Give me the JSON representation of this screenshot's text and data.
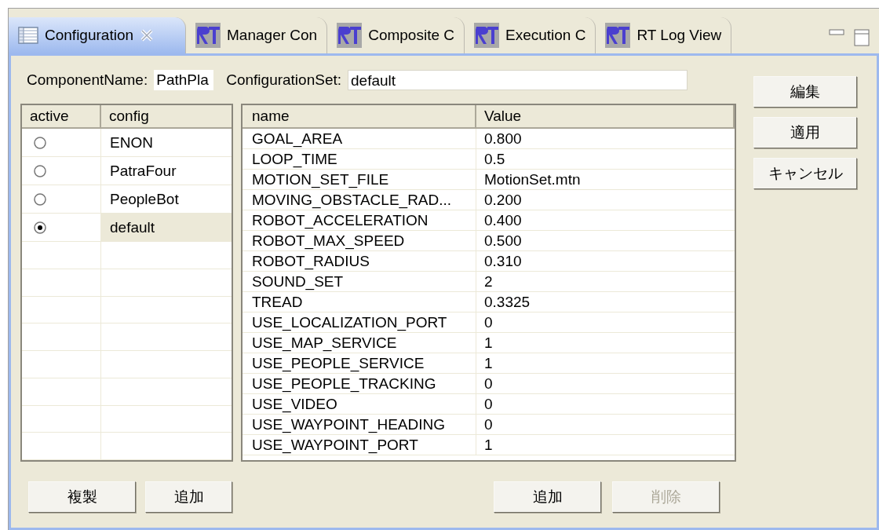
{
  "tabs": [
    {
      "label": "Configuration",
      "kind": "table",
      "selected": true,
      "closable": true
    },
    {
      "label": "Manager Con",
      "kind": "rt",
      "selected": false,
      "closable": false
    },
    {
      "label": "Composite C",
      "kind": "rt",
      "selected": false,
      "closable": false
    },
    {
      "label": "Execution C",
      "kind": "rt",
      "selected": false,
      "closable": false
    },
    {
      "label": "RT Log View",
      "kind": "rt",
      "selected": false,
      "closable": false
    }
  ],
  "component_name": {
    "label": "ComponentName:",
    "value": "PathPla"
  },
  "configuration_set": {
    "label": "ConfigurationSet:",
    "value": "default"
  },
  "config_table": {
    "columns": [
      "active",
      "config"
    ],
    "rows": [
      {
        "config": "ENON",
        "selected": false
      },
      {
        "config": "PatraFour",
        "selected": false
      },
      {
        "config": "PeopleBot",
        "selected": false
      },
      {
        "config": "default",
        "selected": true
      }
    ]
  },
  "param_table": {
    "columns": [
      "name",
      "Value"
    ],
    "rows": [
      {
        "name": "GOAL_AREA",
        "value": "0.800"
      },
      {
        "name": "LOOP_TIME",
        "value": "0.5"
      },
      {
        "name": "MOTION_SET_FILE",
        "value": "MotionSet.mtn"
      },
      {
        "name": "MOVING_OBSTACLE_RAD...",
        "value": "0.200"
      },
      {
        "name": "ROBOT_ACCELERATION",
        "value": "0.400"
      },
      {
        "name": "ROBOT_MAX_SPEED",
        "value": "0.500"
      },
      {
        "name": "ROBOT_RADIUS",
        "value": "0.310"
      },
      {
        "name": "SOUND_SET",
        "value": "2"
      },
      {
        "name": "TREAD",
        "value": "0.3325"
      },
      {
        "name": "USE_LOCALIZATION_PORT",
        "value": "0"
      },
      {
        "name": "USE_MAP_SERVICE",
        "value": "1"
      },
      {
        "name": "USE_PEOPLE_SERVICE",
        "value": "1"
      },
      {
        "name": "USE_PEOPLE_TRACKING",
        "value": "0"
      },
      {
        "name": "USE_VIDEO",
        "value": "0"
      },
      {
        "name": "USE_WAYPOINT_HEADING",
        "value": "0"
      },
      {
        "name": "USE_WAYPOINT_PORT",
        "value": "1"
      }
    ]
  },
  "side_buttons": [
    {
      "label": "編集",
      "disabled": false
    },
    {
      "label": "適用",
      "disabled": false
    },
    {
      "label": "キャンセル",
      "disabled": false
    }
  ],
  "config_buttons": [
    {
      "label": "複製",
      "disabled": false
    },
    {
      "label": "追加",
      "disabled": false
    }
  ],
  "param_buttons": [
    {
      "label": "追加",
      "disabled": false
    },
    {
      "label": "削除",
      "disabled": true
    }
  ]
}
